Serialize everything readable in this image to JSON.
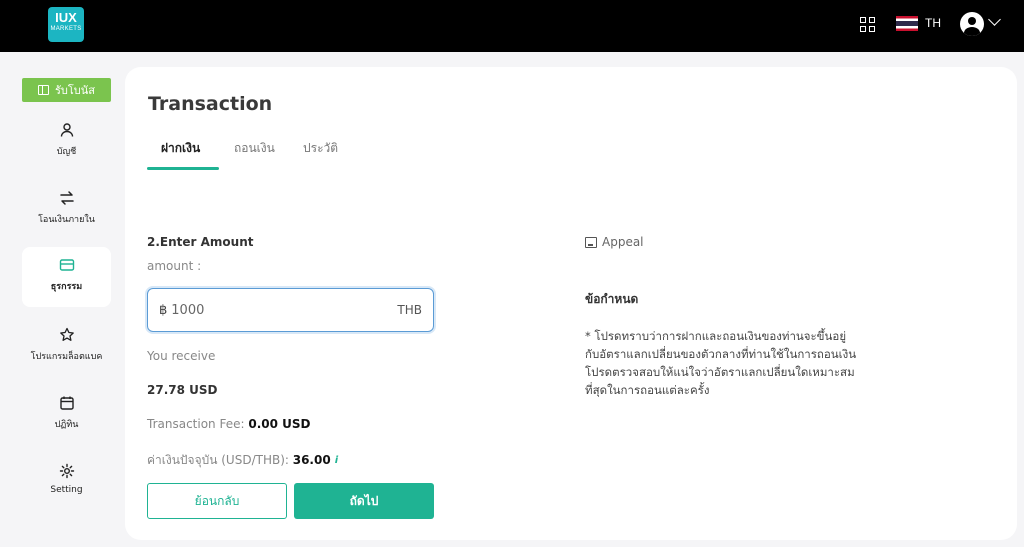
{
  "header": {
    "logo_top": "IUX",
    "logo_bottom": "MARKETS",
    "language": "TH"
  },
  "sidebar": {
    "bonus_label": "รับโบนัส",
    "items": [
      {
        "label": "บัญชี",
        "icon": "user-icon"
      },
      {
        "label": "โอนเงินภายใน",
        "icon": "transfer-icon"
      },
      {
        "label": "ธุรกรรม",
        "icon": "card-icon",
        "active": true
      },
      {
        "label": "โปรแกรมล็อตแบค",
        "icon": "star-icon"
      },
      {
        "label": "ปฏิทิน",
        "icon": "calendar-icon"
      },
      {
        "label": "Setting",
        "icon": "gear-icon"
      }
    ]
  },
  "main": {
    "title": "Transaction",
    "tabs": [
      {
        "label": "ฝากเงิน",
        "active": true
      },
      {
        "label": "ถอนเงิน"
      },
      {
        "label": "ประวัติ"
      }
    ],
    "section_title": "2.Enter Amount",
    "amount_label": "amount :",
    "amount_currency_symbol": "฿",
    "amount_value": "1000",
    "amount_unit": "THB",
    "receive_label": "You receive",
    "receive_value": "27.78 USD",
    "fee_label": "Transaction Fee: ",
    "fee_value": "0.00 USD",
    "rate_label": "ค่าเงินปัจจุบัน (USD/THB): ",
    "rate_value": "36.00",
    "back_button": "ย้อนกลับ",
    "next_button": "ถัดไป",
    "appeal_label": "Appeal",
    "terms_title": "ข้อกำหนด",
    "terms_text": "* โปรดทราบว่าการฝากและถอนเงินของท่านจะขึ้นอยู่กับอัตราแลกเปลี่ยนของตัวกลางที่ท่านใช้ในการถอนเงิน โปรดตรวจสอบให้แน่ใจว่าอัตราแลกเปลี่ยนใดเหมาะสมที่สุดในการถอนแต่ละครั้ง"
  },
  "colors": {
    "accent": "#1fb393",
    "bonus": "#7bc44e",
    "logo": "#1cb5c2"
  }
}
